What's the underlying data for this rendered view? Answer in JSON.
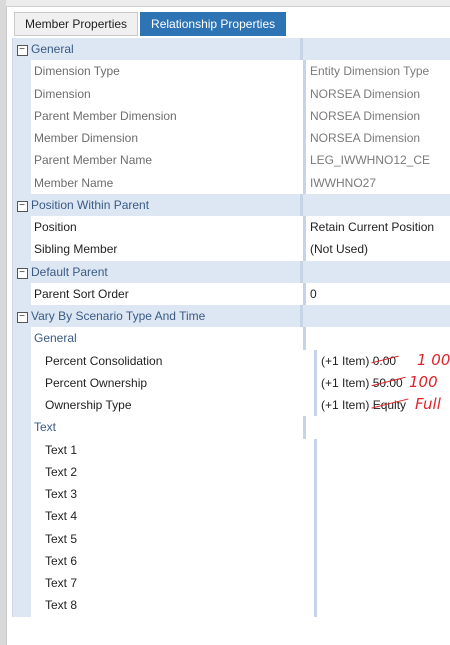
{
  "tabs": [
    {
      "label": "Member Properties",
      "active": false
    },
    {
      "label": "Relationship Properties",
      "active": true
    }
  ],
  "general": {
    "title": "General",
    "rows": [
      {
        "name": "Dimension Type",
        "value": "Entity Dimension Type"
      },
      {
        "name": "Dimension",
        "value": "NORSEA Dimension"
      },
      {
        "name": "Parent Member Dimension",
        "value": "NORSEA Dimension"
      },
      {
        "name": "Member Dimension",
        "value": "NORSEA Dimension"
      },
      {
        "name": "Parent Member Name",
        "value": "LEG_IWWHNO12_CE"
      },
      {
        "name": "Member Name",
        "value": "IWWHNO27"
      }
    ]
  },
  "position": {
    "title": "Position Within Parent",
    "rows": [
      {
        "name": "Position",
        "value": "Retain Current Position"
      },
      {
        "name": "Sibling Member",
        "value": "(Not Used)"
      }
    ]
  },
  "default_parent": {
    "title": "Default Parent",
    "rows": [
      {
        "name": "Parent Sort Order",
        "value": "0"
      }
    ]
  },
  "vary": {
    "title": "Vary By Scenario Type And Time",
    "general_label": "General",
    "rows": [
      {
        "name": "Percent Consolidation",
        "prefix": "(+1 Item)",
        "old_value": "0.00",
        "handwritten": "1 00"
      },
      {
        "name": "Percent Ownership",
        "prefix": "(+1 Item)",
        "old_value": "50.00",
        "handwritten": "100"
      },
      {
        "name": "Ownership Type",
        "prefix": "(+1 Item)",
        "old_value": "Equity",
        "handwritten": "Full"
      }
    ],
    "text_label": "Text",
    "text_rows": [
      "Text 1",
      "Text 2",
      "Text 3",
      "Text 4",
      "Text 5",
      "Text 6",
      "Text 7",
      "Text 8"
    ]
  },
  "icons": {
    "collapse": "collapse-icon"
  },
  "colors": {
    "accent": "#2e74b5",
    "category_bg": "#dde7f3",
    "handwriting": "#e0232a"
  }
}
